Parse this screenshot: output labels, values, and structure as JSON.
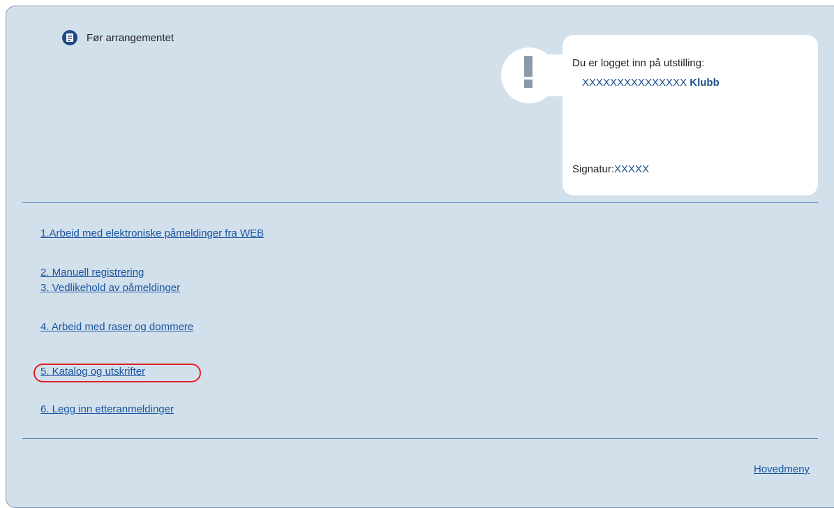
{
  "section": {
    "title": "Før arrangementet",
    "icon": "document-icon"
  },
  "notice": {
    "icon": "exclamation-icon",
    "logged_in_label": "Du er logget inn på utstilling:",
    "show_name": "XXXXXXXXXXXXXXX",
    "club_label": "Klubb",
    "signature_label": "Signatur:",
    "signature_value": "XXXXX"
  },
  "menu": {
    "items": [
      {
        "label": "1.Arbeid med elektroniske påmeldinger fra WEB"
      },
      {
        "label": "2. Manuell registrering"
      },
      {
        "label": "3. Vedlikehold av påmeldinger"
      },
      {
        "label": "4. Arbeid med raser og dommere"
      },
      {
        "label": "5. Katalog og utskrifter",
        "highlighted": true
      },
      {
        "label": "6. Legg inn etteranmeldinger"
      }
    ]
  },
  "footer": {
    "main_menu_label": "Hovedmeny"
  },
  "colors": {
    "panel_bg": "#d2e0ec",
    "link": "#1a55a0",
    "highlight": "#e02020",
    "divider": "#5b87b8"
  }
}
